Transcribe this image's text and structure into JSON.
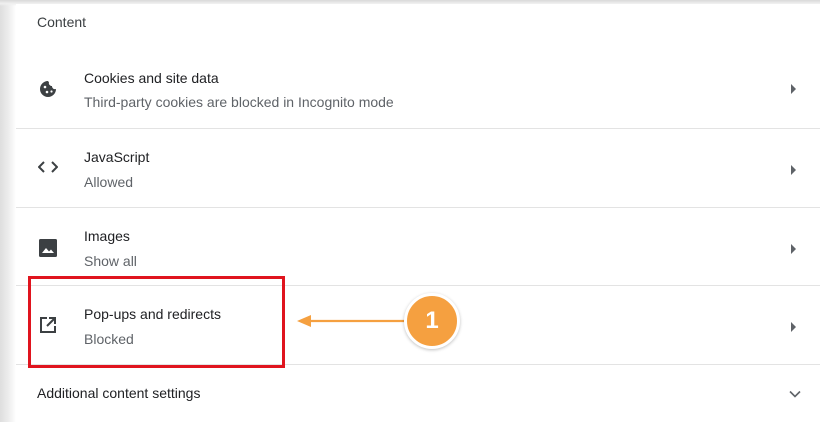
{
  "section": {
    "title": "Content"
  },
  "rows": [
    {
      "title": "Cookies and site data",
      "subtitle": "Third-party cookies are blocked in Incognito mode",
      "icon": "cookie-icon"
    },
    {
      "title": "JavaScript",
      "subtitle": "Allowed",
      "icon": "code-icon"
    },
    {
      "title": "Images",
      "subtitle": "Show all",
      "icon": "image-icon"
    },
    {
      "title": "Pop-ups and redirects",
      "subtitle": "Blocked",
      "icon": "open-in-new-icon"
    }
  ],
  "additional": {
    "label": "Additional content settings",
    "icon": "chevron-down-icon"
  },
  "annotation": {
    "badge_number": "1",
    "highlight_color": "#e0141e",
    "badge_color": "#f5a040"
  }
}
